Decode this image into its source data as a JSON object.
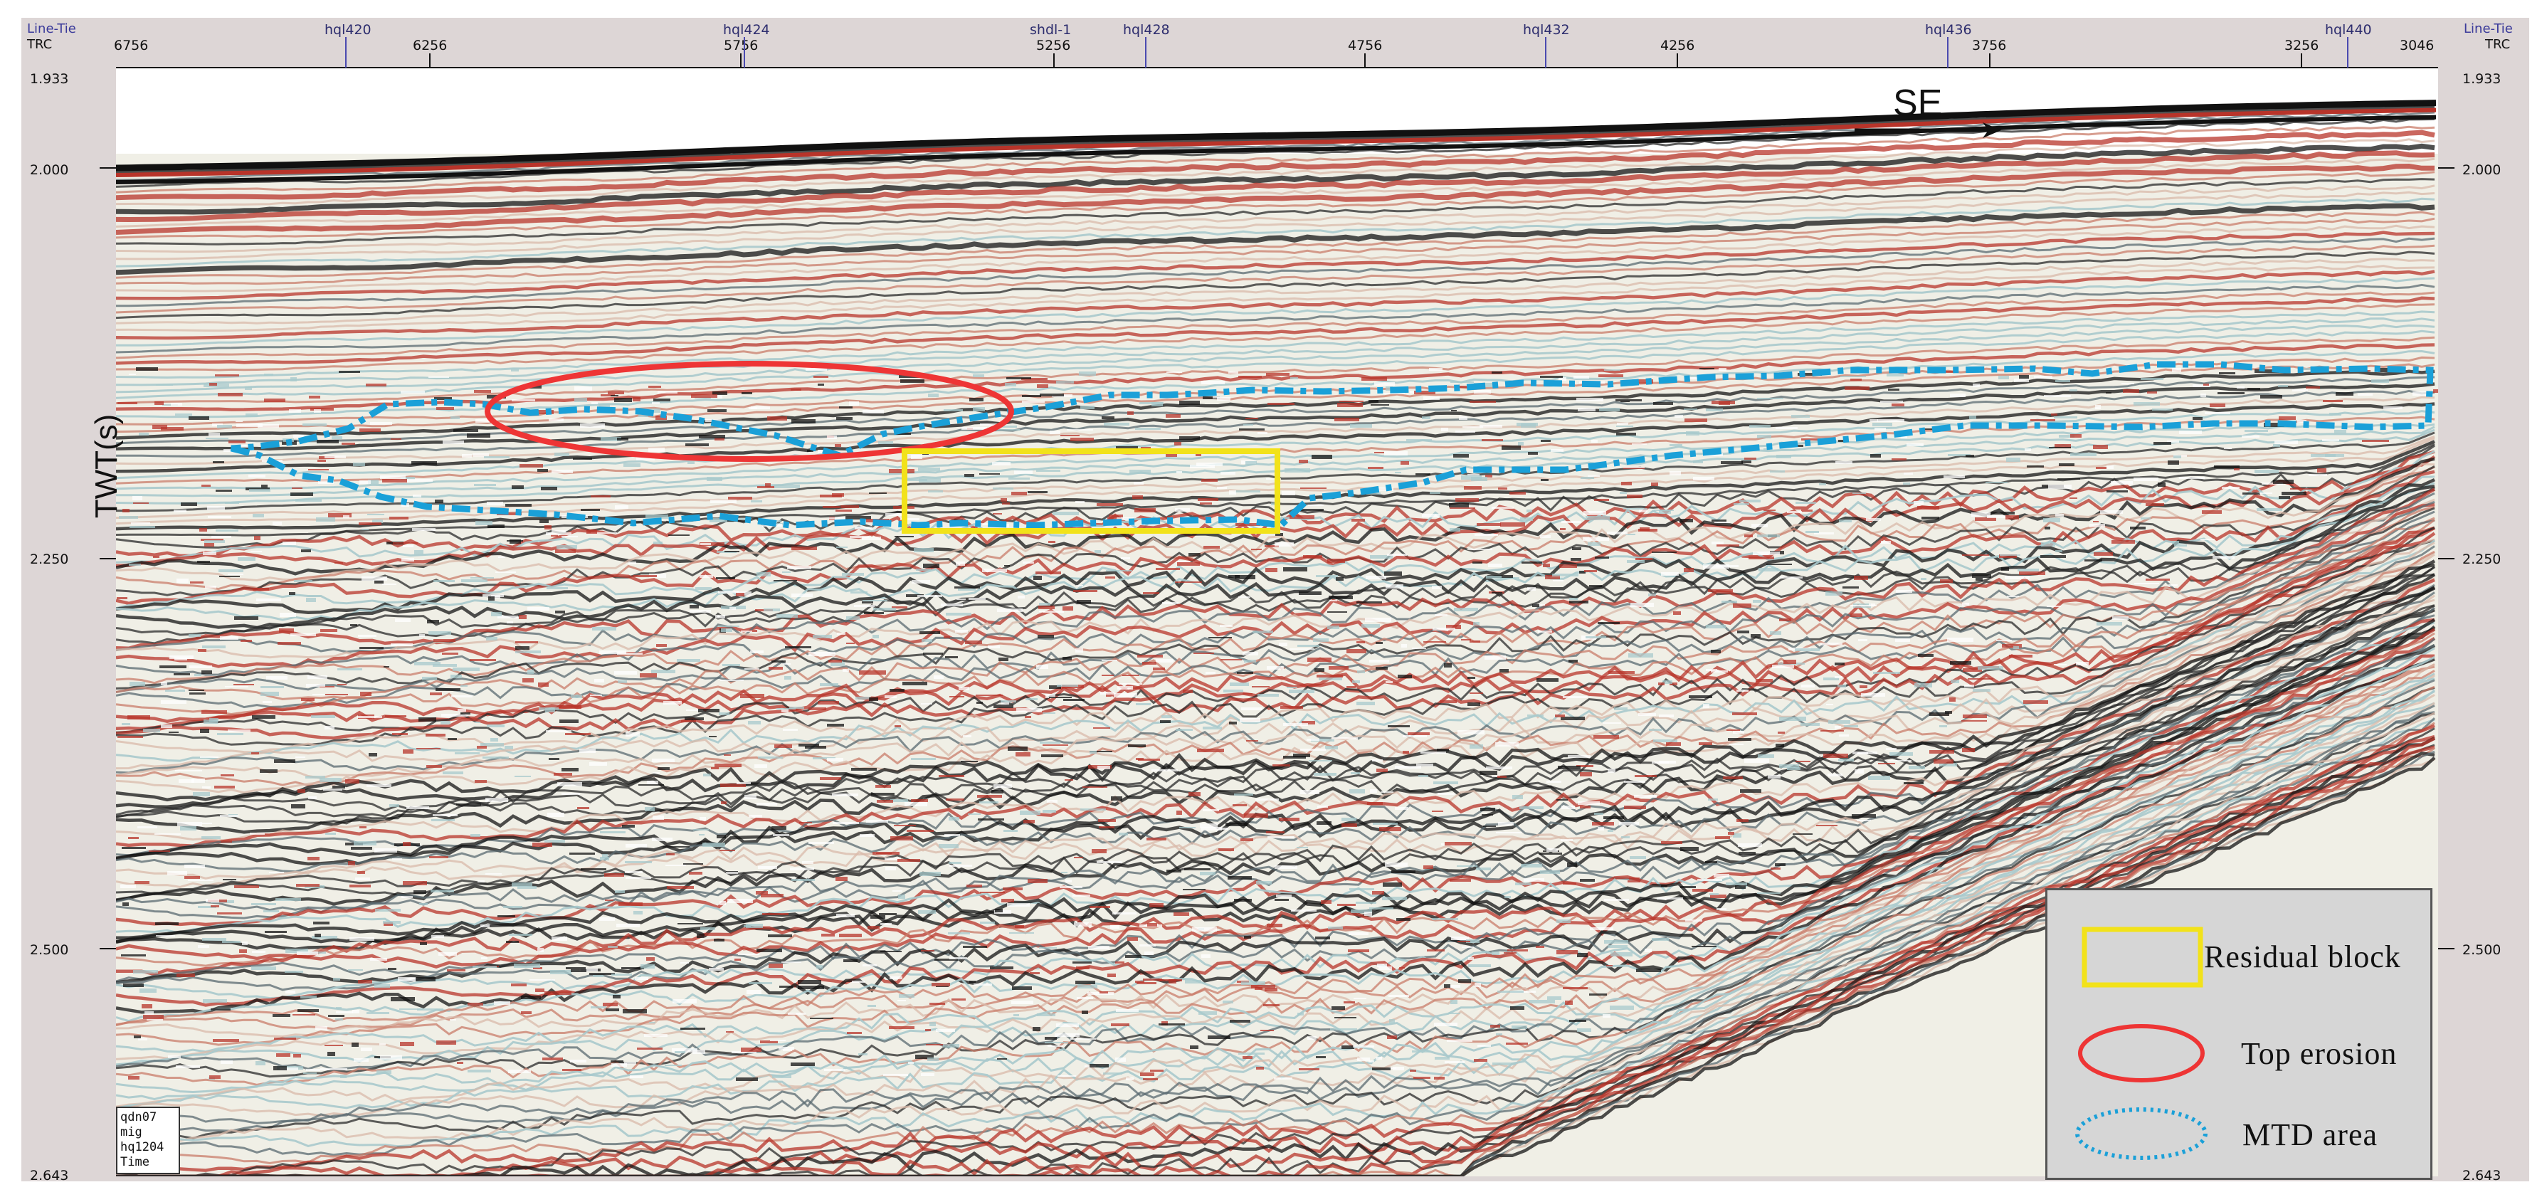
{
  "header": {
    "left_line_tie": "Line-Tie",
    "left_trc": "TRC",
    "right_line_tie": "Line-Tie",
    "right_trc": "TRC"
  },
  "trace_ticks": [
    "6756",
    "6256",
    "5756",
    "5256",
    "4756",
    "4256",
    "3756",
    "3256",
    "3046"
  ],
  "well_ties": [
    "hql420",
    "hql424",
    "shdl-1",
    "hql428",
    "hql432",
    "hql436",
    "hql440"
  ],
  "y_axis": {
    "label": "TWT(s)",
    "ticks": [
      "1.933",
      "2.000",
      "2.250",
      "2.500",
      "2.643"
    ]
  },
  "direction": {
    "label": "SE"
  },
  "legend": {
    "items": [
      {
        "label": "Residual block",
        "color": "#f2e21a",
        "shape": "rectangle"
      },
      {
        "label": "Top erosion",
        "color": "#ee3535",
        "shape": "ellipse"
      },
      {
        "label": "MTD area",
        "color": "#1aa0d8",
        "shape": "dotted-ellipse"
      }
    ]
  },
  "info_box": {
    "lines": [
      "qdn07",
      "mig",
      "hq1204",
      "Time"
    ]
  },
  "colors": {
    "trough": "#111111",
    "peak": "#c0392b",
    "background": "#f0efe6",
    "mtd_outline": "#1aa0d8",
    "erosion_outline": "#ee3535",
    "residual_outline": "#f2e21a"
  }
}
